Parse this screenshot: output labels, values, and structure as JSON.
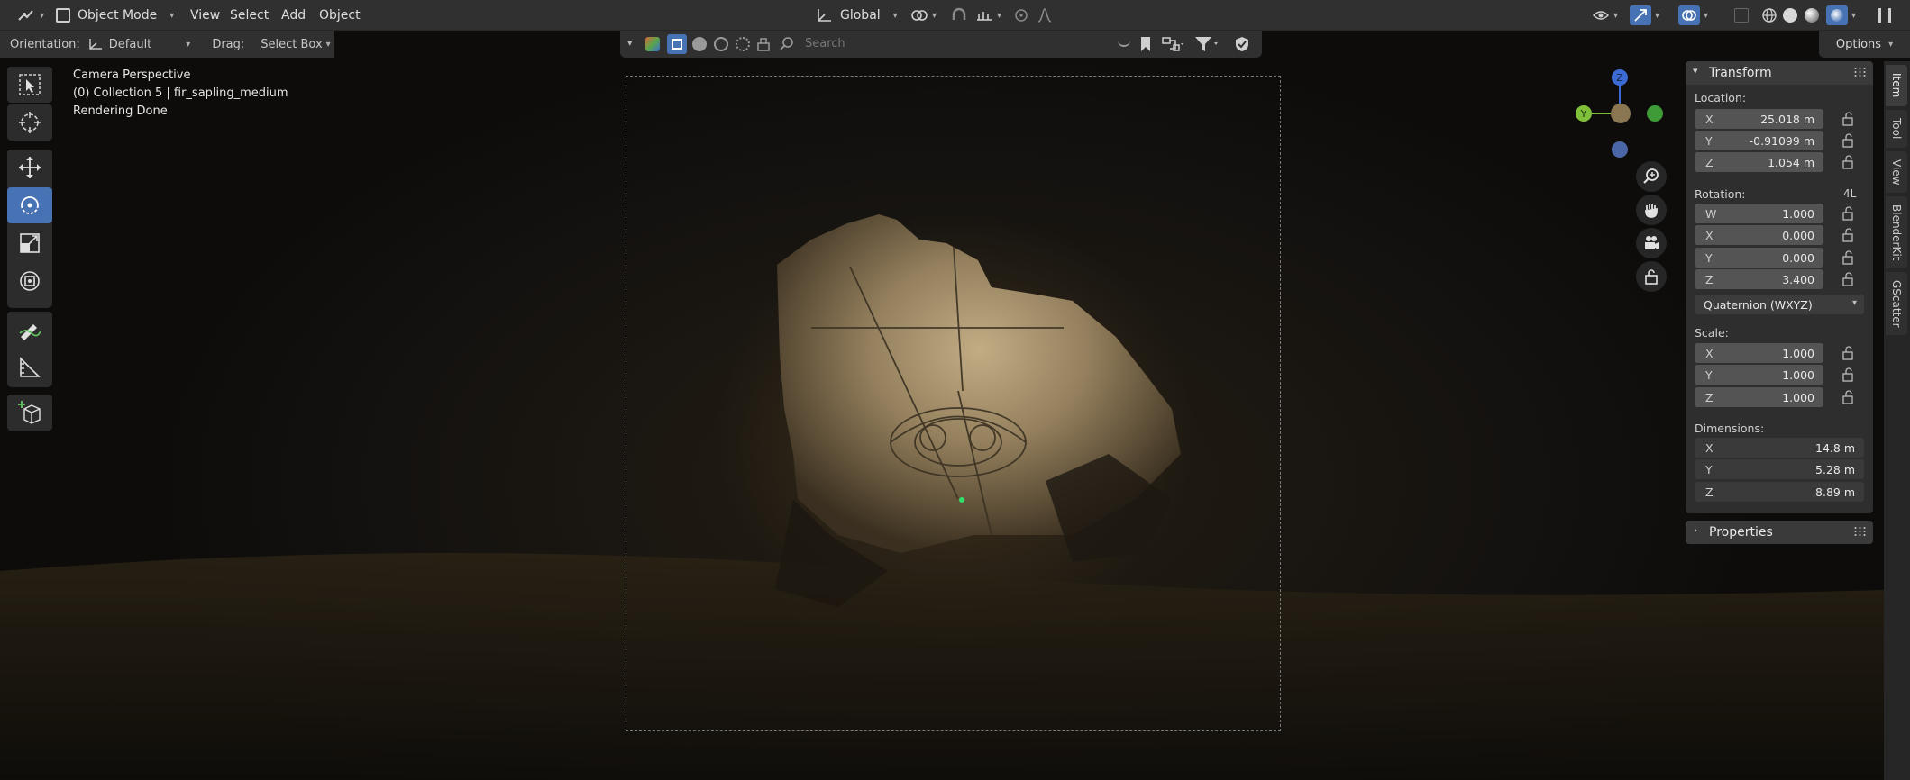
{
  "header": {
    "mode": "Object Mode",
    "menus": [
      "View",
      "Select",
      "Add",
      "Object"
    ],
    "transform_orientation": "Global"
  },
  "tool_options": {
    "orientation_label": "Orientation:",
    "orientation_value": "Default",
    "drag_label": "Drag:",
    "drag_value": "Select Box"
  },
  "viewport_header": {
    "search_placeholder": "Search",
    "options_label": "Options"
  },
  "overlay": {
    "view_name": "Camera Perspective",
    "collection_info": "(0) Collection 5 | fir_sapling_medium",
    "status": "Rendering Done"
  },
  "gizmo": {
    "z": "Z",
    "y": "Y"
  },
  "transform_panel": {
    "title": "Transform",
    "location_label": "Location:",
    "location": [
      {
        "axis": "X",
        "value": "25.018 m"
      },
      {
        "axis": "Y",
        "value": "-0.91099 m"
      },
      {
        "axis": "Z",
        "value": "1.054 m"
      }
    ],
    "rotation_label": "Rotation:",
    "rotation_lock_mode": "4L",
    "rotation": [
      {
        "axis": "W",
        "value": "1.000"
      },
      {
        "axis": "X",
        "value": "0.000"
      },
      {
        "axis": "Y",
        "value": "0.000"
      },
      {
        "axis": "Z",
        "value": "3.400"
      }
    ],
    "rotation_mode": "Quaternion (WXYZ)",
    "scale_label": "Scale:",
    "scale": [
      {
        "axis": "X",
        "value": "1.000"
      },
      {
        "axis": "Y",
        "value": "1.000"
      },
      {
        "axis": "Z",
        "value": "1.000"
      }
    ],
    "dimensions_label": "Dimensions:",
    "dimensions": [
      {
        "axis": "X",
        "value": "14.8 m"
      },
      {
        "axis": "Y",
        "value": "5.28 m"
      },
      {
        "axis": "Z",
        "value": "8.89 m"
      }
    ]
  },
  "properties_panel": {
    "title": "Properties"
  },
  "side_tabs": [
    "Item",
    "Tool",
    "View",
    "BlenderKit",
    "GScatter"
  ],
  "colors": {
    "accent": "#4772b3",
    "gizmo_x": "#3f9b37",
    "gizmo_y": "#7fbf3a",
    "gizmo_z": "#3d6bd6"
  }
}
